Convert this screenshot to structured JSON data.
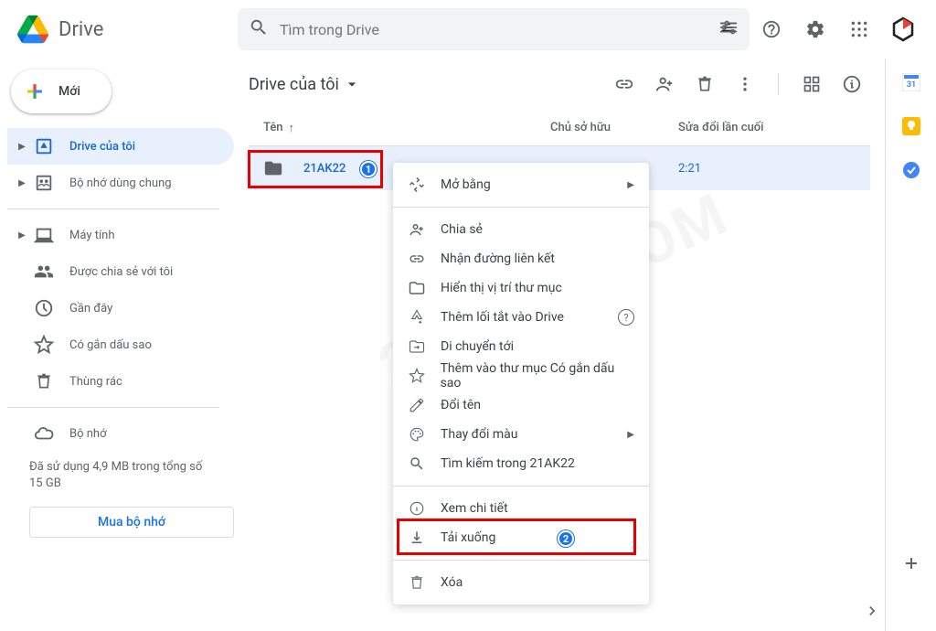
{
  "header": {
    "app_name": "Drive",
    "search_placeholder": "Tìm trong Drive"
  },
  "sidebar": {
    "new_button": "Mới",
    "items": [
      {
        "label": "Drive của tôi",
        "icon": "drive",
        "arrow": true,
        "active": true
      },
      {
        "label": "Bộ nhớ dùng chung",
        "icon": "shared-drive",
        "arrow": true
      },
      {
        "label": "Máy tính",
        "icon": "computer",
        "arrow": true,
        "divider_before": true
      },
      {
        "label": "Được chia sẻ với tôi",
        "icon": "people"
      },
      {
        "label": "Gần đây",
        "icon": "clock"
      },
      {
        "label": "Có gắn dấu sao",
        "icon": "star"
      },
      {
        "label": "Thùng rác",
        "icon": "trash"
      },
      {
        "label": "Bộ nhớ",
        "icon": "cloud",
        "divider_before": true
      }
    ],
    "storage_text": "Đã sử dụng 4,9 MB trong tổng số 15 GB",
    "buy_storage": "Mua bộ nhớ"
  },
  "breadcrumb": "Drive của tôi",
  "columns": {
    "name": "Tên",
    "owner": "Chủ sở hữu",
    "modified": "Sửa đổi lần cuối"
  },
  "files": [
    {
      "name": "21AK22",
      "modified_visible": "2:21"
    }
  ],
  "context_menu": {
    "open_with": "Mở bằng",
    "share": "Chia sẻ",
    "get_link": "Nhận đường liên kết",
    "show_location": "Hiển thị vị trí thư mục",
    "add_shortcut": "Thêm lối tắt vào Drive",
    "move_to": "Di chuyển tới",
    "add_to_starred": "Thêm vào thư mục Có gắn dấu sao",
    "rename": "Đổi tên",
    "change_color": "Thay đổi màu",
    "search_within": "Tìm kiếm trong 21AK22",
    "view_details": "Xem chi tiết",
    "download": "Tải xuống",
    "remove": "Xóa"
  },
  "annotations": {
    "badge1": "1",
    "badge2": "2"
  },
  "watermark": "21AK22.COM"
}
